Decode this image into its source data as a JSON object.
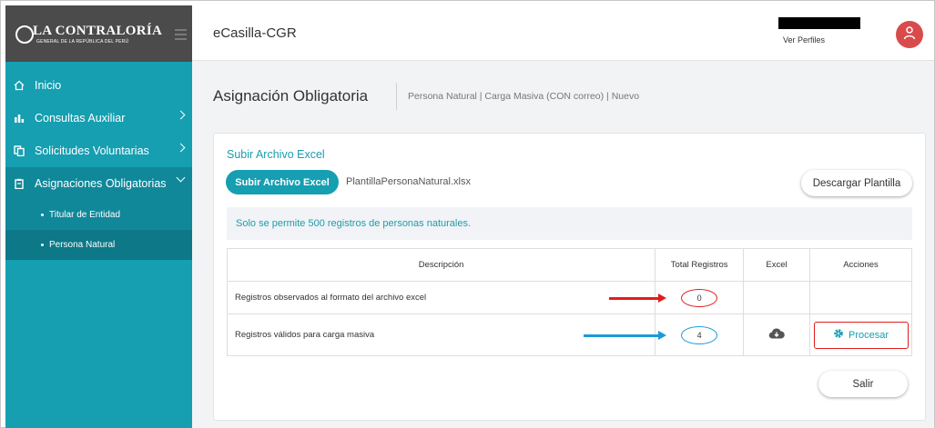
{
  "brand": {
    "logo_title": "LA CONTRALORÍA",
    "logo_subtitle": "GENERAL DE LA REPÚBLICA DEL PERÚ"
  },
  "sidebar": {
    "items": [
      {
        "label": "Inicio",
        "icon": "home-icon"
      },
      {
        "label": "Consultas Auxiliar",
        "icon": "bar-chart-icon"
      },
      {
        "label": "Solicitudes Voluntarias",
        "icon": "copy-icon"
      },
      {
        "label": "Asignaciones Obligatorias",
        "icon": "clipboard-icon"
      }
    ],
    "subitems": [
      {
        "label": "Titular de Entidad"
      },
      {
        "label": "Persona Natural"
      }
    ]
  },
  "header": {
    "app_title": "eCasilla-CGR",
    "profile_link": "Ver Perfiles",
    "avatar_icon": "user-icon"
  },
  "page": {
    "title": "Asignación Obligatoria",
    "breadcrumb": "Persona Natural | Carga Masiva (CON correo) | Nuevo"
  },
  "upload_card": {
    "title": "Subir Archivo Excel",
    "upload_button": "Subir Archivo Excel",
    "file_name": "PlantillaPersonaNatural.xlsx",
    "download_button": "Descargar Plantilla",
    "info": "Solo se permite 500 registros de personas naturales.",
    "table": {
      "headers": [
        "Descripción",
        "Total Registros",
        "Excel",
        "Acciones"
      ],
      "rows": [
        {
          "description": "Registros observados al formato del archivo excel",
          "total": "0"
        },
        {
          "description": "Registros válidos para carga masiva",
          "total": "4",
          "action": "Procesar"
        }
      ]
    },
    "exit_button": "Salir"
  },
  "colors": {
    "sidebar": "#169eb1",
    "sidebar_active": "#10889a",
    "accent": "#169eb1",
    "highlight_red": "#e11d1d",
    "highlight_blue": "#1a9bd7",
    "avatar": "#d94b4b"
  }
}
